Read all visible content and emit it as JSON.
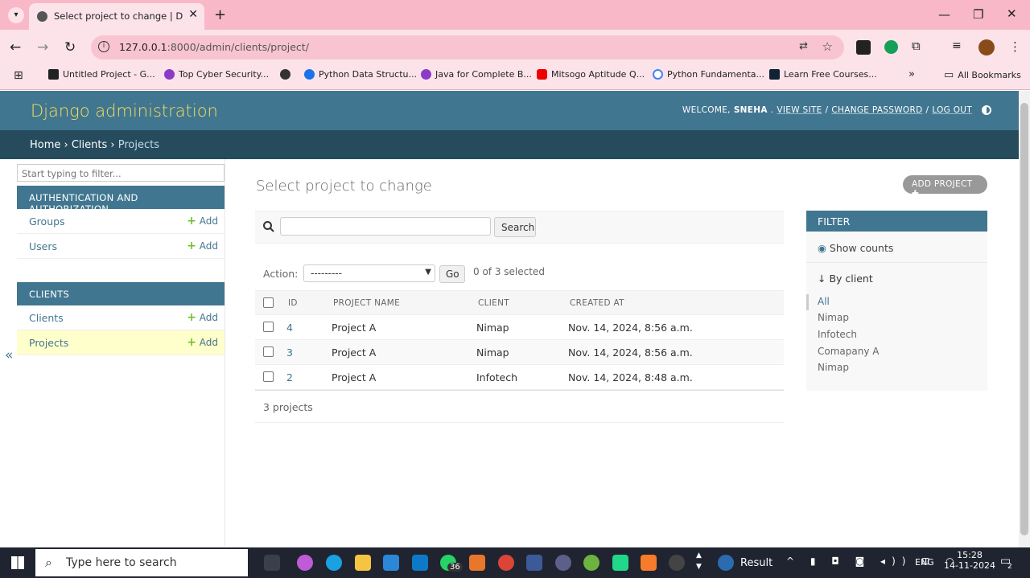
{
  "browser": {
    "tab_title": "Select project to change | Djang",
    "url_host": "127.0.0.1",
    "url_rest": ":8000/admin/clients/project/",
    "bookmarks": [
      "Untitled Project - G...",
      "Top Cyber Security...",
      "Python Data Structu...",
      "Java for Complete B...",
      "Mitsogo Aptitude Q...",
      "Python Fundamenta...",
      "Learn Free Courses..."
    ],
    "all_bookmarks": "All Bookmarks"
  },
  "header": {
    "branding": "Django administration",
    "welcome": "WELCOME,",
    "user": "SNEHA",
    "view_site": "VIEW SITE",
    "change_password": "CHANGE PASSWORD",
    "log_out": "LOG OUT"
  },
  "breadcrumbs": {
    "home": "Home",
    "app": "Clients",
    "current": "Projects"
  },
  "sidebar": {
    "filter_placeholder": "Start typing to filter...",
    "modules": [
      {
        "caption": "AUTHENTICATION AND AUTHORIZATION",
        "items": [
          {
            "name": "Groups",
            "add": "Add"
          },
          {
            "name": "Users",
            "add": "Add"
          }
        ]
      },
      {
        "caption": "CLIENTS",
        "items": [
          {
            "name": "Clients",
            "add": "Add"
          },
          {
            "name": "Projects",
            "add": "Add"
          }
        ]
      }
    ],
    "collapse": "«"
  },
  "content": {
    "title": "Select project to change",
    "add_button": "ADD PROJECT",
    "search_button": "Search",
    "action_label": "Action:",
    "action_value": "---------",
    "go": "Go",
    "selected": "0 of 3 selected",
    "columns": [
      "ID",
      "PROJECT NAME",
      "CLIENT",
      "CREATED AT"
    ],
    "rows": [
      {
        "id": "4",
        "name": "Project A",
        "client": "Nimap",
        "created": "Nov. 14, 2024, 8:56 a.m."
      },
      {
        "id": "3",
        "name": "Project A",
        "client": "Nimap",
        "created": "Nov. 14, 2024, 8:56 a.m."
      },
      {
        "id": "2",
        "name": "Project A",
        "client": "Infotech",
        "created": "Nov. 14, 2024, 8:48 a.m."
      }
    ],
    "paginator": "3 projects"
  },
  "filter": {
    "caption": "FILTER",
    "show_counts": "Show counts",
    "by_client": "↓ By client",
    "options": [
      "All",
      "Nimap",
      "Infotech",
      "Comapany A",
      "Nimap"
    ]
  },
  "taskbar": {
    "search": "Type here to search",
    "whatsapp_badge": "36",
    "weather": "Result",
    "lang": "ENG",
    "time": "15:28",
    "date": "14-11-2024",
    "notif": "2"
  },
  "colors": {
    "header": "#417690",
    "breadcrumbs": "#264b5d",
    "branding": "#f5dd5d",
    "selected_row": "#ffffcc",
    "add_plus": "#70bf2b"
  }
}
